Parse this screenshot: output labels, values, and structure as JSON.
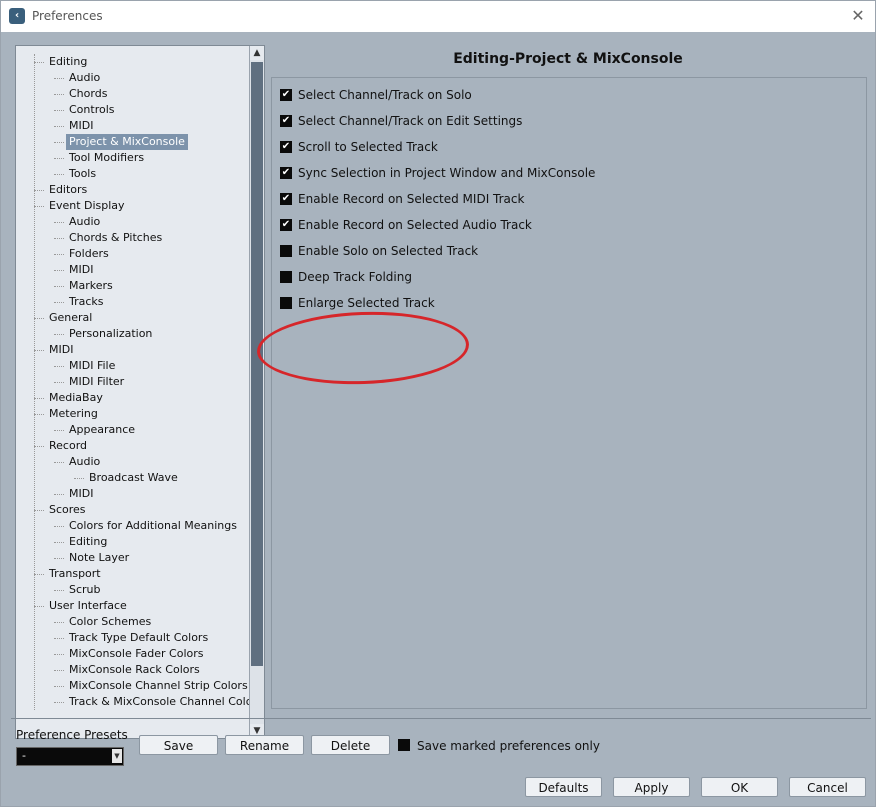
{
  "window": {
    "title": "Preferences",
    "app_icon": "cubase-logo",
    "close_glyph": "✕"
  },
  "tree": {
    "items": [
      {
        "label": "Editing",
        "level": 1
      },
      {
        "label": "Audio",
        "level": 2
      },
      {
        "label": "Chords",
        "level": 2
      },
      {
        "label": "Controls",
        "level": 2
      },
      {
        "label": "MIDI",
        "level": 2
      },
      {
        "label": "Project & MixConsole",
        "level": 2,
        "selected": true
      },
      {
        "label": "Tool Modifiers",
        "level": 2
      },
      {
        "label": "Tools",
        "level": 2
      },
      {
        "label": "Editors",
        "level": 1
      },
      {
        "label": "Event Display",
        "level": 1
      },
      {
        "label": "Audio",
        "level": 2
      },
      {
        "label": "Chords & Pitches",
        "level": 2
      },
      {
        "label": "Folders",
        "level": 2
      },
      {
        "label": "MIDI",
        "level": 2
      },
      {
        "label": "Markers",
        "level": 2
      },
      {
        "label": "Tracks",
        "level": 2
      },
      {
        "label": "General",
        "level": 1
      },
      {
        "label": "Personalization",
        "level": 2
      },
      {
        "label": "MIDI",
        "level": 1
      },
      {
        "label": "MIDI File",
        "level": 2
      },
      {
        "label": "MIDI Filter",
        "level": 2
      },
      {
        "label": "MediaBay",
        "level": 1
      },
      {
        "label": "Metering",
        "level": 1
      },
      {
        "label": "Appearance",
        "level": 2
      },
      {
        "label": "Record",
        "level": 1
      },
      {
        "label": "Audio",
        "level": 2
      },
      {
        "label": "Broadcast Wave",
        "level": 3
      },
      {
        "label": "MIDI",
        "level": 2
      },
      {
        "label": "Scores",
        "level": 1
      },
      {
        "label": "Colors for Additional Meanings",
        "level": 2
      },
      {
        "label": "Editing",
        "level": 2
      },
      {
        "label": "Note Layer",
        "level": 2
      },
      {
        "label": "Transport",
        "level": 1
      },
      {
        "label": "Scrub",
        "level": 2
      },
      {
        "label": "User Interface",
        "level": 1
      },
      {
        "label": "Color Schemes",
        "level": 2
      },
      {
        "label": "Track Type Default Colors",
        "level": 2
      },
      {
        "label": "MixConsole Fader Colors",
        "level": 2
      },
      {
        "label": "MixConsole Rack Colors",
        "level": 2
      },
      {
        "label": "MixConsole Channel Strip Colors",
        "level": 2
      },
      {
        "label": "Track & MixConsole Channel Colors",
        "level": 2
      }
    ],
    "scroll_up_glyph": "▲",
    "scroll_down_glyph": "▼"
  },
  "panel": {
    "heading": "Editing-Project & MixConsole",
    "options": [
      {
        "label": "Select Channel/Track on Solo",
        "checked": true
      },
      {
        "label": "Select Channel/Track on Edit Settings",
        "checked": true
      },
      {
        "label": "Scroll to Selected Track",
        "checked": true
      },
      {
        "label": "Sync Selection in Project Window and MixConsole",
        "checked": true
      },
      {
        "label": "Enable Record on Selected MIDI Track",
        "checked": true
      },
      {
        "label": "Enable Record on Selected Audio Track",
        "checked": true
      },
      {
        "label": "Enable Solo on Selected Track",
        "checked": false
      },
      {
        "label": "Deep Track Folding",
        "checked": false
      },
      {
        "label": "Enlarge Selected Track",
        "checked": false
      }
    ],
    "check_glyph": "✔"
  },
  "footer": {
    "presets_label": "Preference Presets",
    "presets_value": "-",
    "presets_arrow": "▼",
    "save_label": "Save",
    "rename_label": "Rename",
    "delete_label": "Delete",
    "save_marked_label": "Save marked preferences only",
    "defaults_label": "Defaults",
    "apply_label": "Apply",
    "ok_label": "OK",
    "cancel_label": "Cancel"
  },
  "colors": {
    "annotation": "#d6262a",
    "selected_item": "#7d93ab",
    "panel_bg": "#a8b3be"
  }
}
